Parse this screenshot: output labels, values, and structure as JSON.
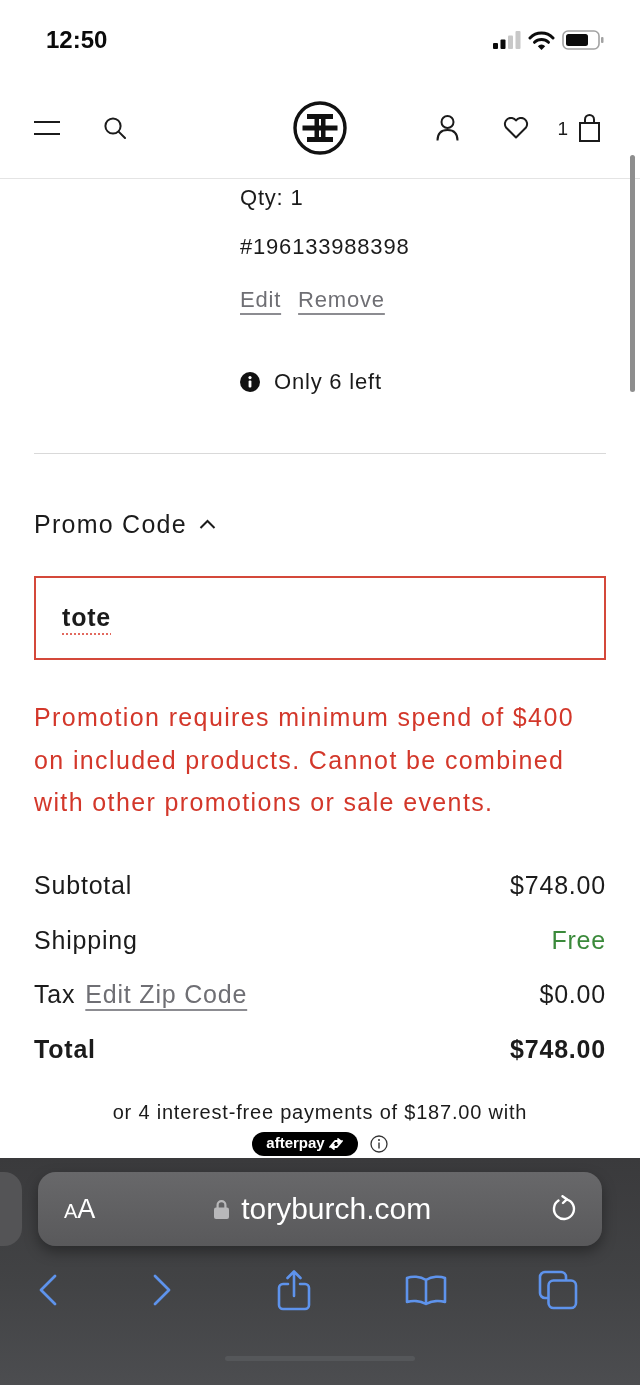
{
  "status_bar": {
    "time": "12:50"
  },
  "header": {
    "cart_count": "1"
  },
  "cart_item": {
    "quantity": "Qty: 1",
    "sku": "#196133988398",
    "actions": [
      "Edit",
      "Remove"
    ],
    "stock_notice": "Only 6 left"
  },
  "promo_code": {
    "label": "Promo Code",
    "expanded": true,
    "value": "tote",
    "invalid": true,
    "error": "Promotion requires minimum spend of $400 on included products. Cannot be combined with other promotions or sale events."
  },
  "summary": {
    "rows": [
      {
        "kind": "plain",
        "label": "Subtotal",
        "value": "$748.00"
      },
      {
        "kind": "free",
        "label": "Shipping",
        "value": "Free"
      },
      {
        "kind": "link",
        "label": "Tax",
        "link": "Edit Zip Code",
        "value": "$0.00"
      },
      {
        "kind": "total",
        "label": "Total",
        "value": "$748.00"
      }
    ]
  },
  "afterpay": {
    "text": "or 4 interest-free payments of $187.00 with",
    "badge": "afterpay"
  },
  "browser_toolbar": {
    "text_size_button": "AA",
    "url": "toryburch.com"
  }
}
